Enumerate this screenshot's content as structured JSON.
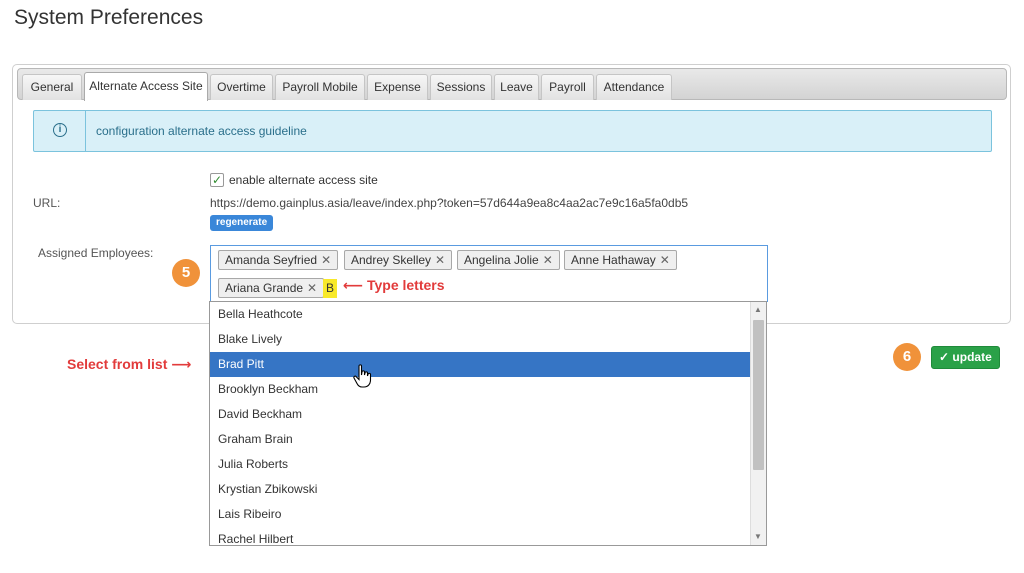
{
  "page": {
    "title": "System Preferences"
  },
  "tabs": [
    {
      "label": "General"
    },
    {
      "label": "Alternate Access Site"
    },
    {
      "label": "Overtime"
    },
    {
      "label": "Payroll Mobile"
    },
    {
      "label": "Expense"
    },
    {
      "label": "Sessions"
    },
    {
      "label": "Leave"
    },
    {
      "label": "Payroll"
    },
    {
      "label": "Attendance"
    }
  ],
  "info": {
    "icon": "info-icon",
    "link": "configuration alternate access guideline"
  },
  "form": {
    "enable_label": "enable alternate access site",
    "enable_checked": true,
    "url_label": "URL:",
    "url_value": "https://demo.gainplus.asia/leave/index.php?token=57d644a9ea8c4aa2ac7e9c16a5fa0db5",
    "regenerate_label": "regenerate",
    "employees_label": "Assigned Employees:",
    "selected_employees": [
      "Amanda Seyfried",
      "Andrey Skelley",
      "Angelina Jolie",
      "Anne Hathaway",
      "Ariana Grande"
    ],
    "typed_value": "B"
  },
  "dropdown": {
    "items": [
      "Bella Heathcote",
      "Blake Lively",
      "Brad Pitt",
      "Brooklyn Beckham",
      "David Beckham",
      "Graham Brain",
      "Julia Roberts",
      "Krystian Zbikowski",
      "Lais Ribeiro",
      "Rachel Hilbert"
    ],
    "highlighted": "Brad Pitt"
  },
  "annotations": {
    "step5": "5",
    "step6": "6",
    "type_letters": "Type letters",
    "select_from_list": "Select from list"
  },
  "actions": {
    "update_label": "update"
  },
  "colors": {
    "accent": "#3675c5",
    "update_green": "#2aa148",
    "badge_orange": "#f0923a",
    "annotation_red": "#e23b3b"
  }
}
